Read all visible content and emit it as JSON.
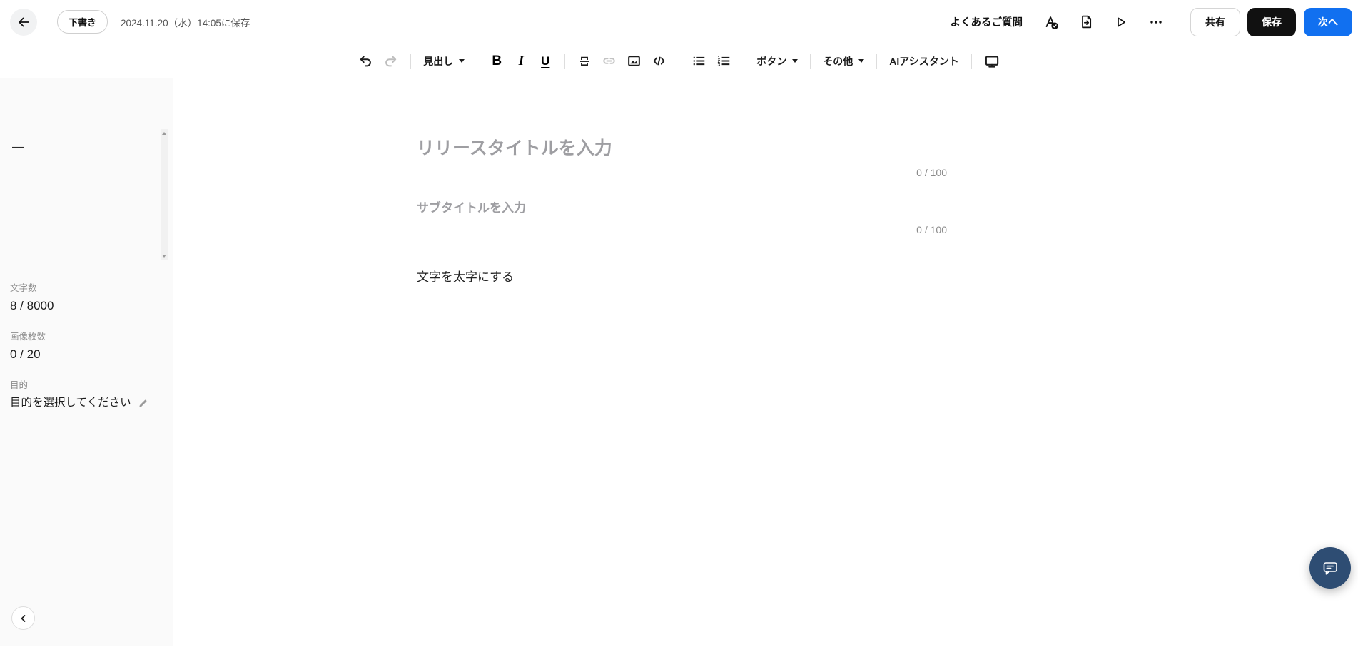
{
  "colors": {
    "accent_blue": "#1170f0",
    "save_black": "#111111",
    "chat_navy": "#2e4d73"
  },
  "header": {
    "status_badge": "下書き",
    "saved_at": "2024.11.20（水）14:05に保存",
    "faq_label": "よくあるご質問",
    "share_label": "共有",
    "save_label": "保存",
    "next_label": "次へ"
  },
  "toolbar": {
    "heading": "見出し",
    "bold": "B",
    "italic": "I",
    "underline": "U",
    "button_menu": "ボタン",
    "others_menu": "その他",
    "ai_assistant": "AIアシスタント"
  },
  "sidebar": {
    "outline_dash": "—",
    "char_count_label": "文字数",
    "char_count_value": "8 / 8000",
    "image_count_label": "画像枚数",
    "image_count_value": "0 / 20",
    "purpose_label": "目的",
    "purpose_value": "目的を選択してください"
  },
  "editor": {
    "title_placeholder": "リリースタイトルを入力",
    "title_counter": "0 / 100",
    "subtitle_placeholder": "サブタイトルを入力",
    "subtitle_counter": "0 / 100",
    "body_text": "文字を太字にする"
  },
  "icons": {
    "back": "left-arrow",
    "proofread": "A-with-check",
    "export_document": "page-with-arrow",
    "preview_play": "play-triangle-outline",
    "more": "horizontal-ellipsis",
    "undo": "curved-arrow-left",
    "redo": "curved-arrow-right",
    "divider_block": "section-break",
    "link": "chain",
    "image": "picture-mountain",
    "code": "angle-brackets-slash",
    "bullet_list": "unordered-list",
    "numbered_list": "ordered-list",
    "display": "monitor",
    "edit": "pencil",
    "chat": "speech-bubble",
    "collapse": "chevron-left"
  }
}
